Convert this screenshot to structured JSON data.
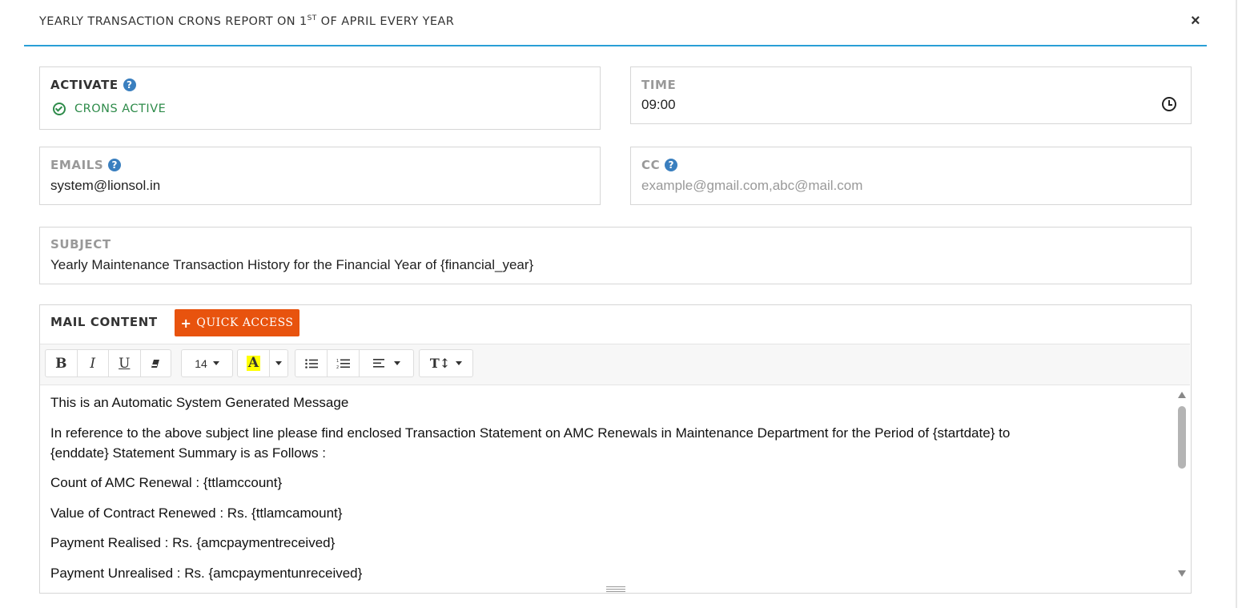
{
  "modal": {
    "title": "YEARLY TRANSACTION CRONS REPORT ON 1",
    "title_sup": "ST",
    "title_rest": " OF APRIL EVERY YEAR",
    "close_label": "×"
  },
  "activate": {
    "label": "ACTIVATE",
    "help": "?",
    "status": "CRONS ACTIVE",
    "status_color": "#2e8b4a"
  },
  "time": {
    "label": "TIME",
    "value": "09:00"
  },
  "emails": {
    "label": "EMAILS",
    "help": "?",
    "value": "system@lionsol.in"
  },
  "cc": {
    "label": "CC",
    "help": "?",
    "placeholder": "example@gmail.com,abc@mail.com"
  },
  "subject": {
    "label": "SUBJECT",
    "value": "Yearly Maintenance Transaction History for the Financial Year of {financial_year}"
  },
  "mail_content": {
    "label": "MAIL CONTENT",
    "quick_access": "QUICK ACCESS",
    "toolbar": {
      "bold": "B",
      "italic": "I",
      "underline": "U",
      "font_size": "14",
      "color_letter": "A",
      "highlight_color": "#ffff00",
      "text_size": "T↕"
    },
    "paragraphs": [
      "This is an Automatic System Generated Message",
      "In reference to the above subject line please find enclosed Transaction Statement on AMC Renewals in Maintenance Department for the Period of {startdate} to {enddate} Statement Summary is as Follows :",
      "Count of AMC Renewal : {ttlamccount}",
      "Value of Contract Renewed : Rs. {ttlamcamount}",
      "Payment Realised : Rs. {amcpaymentreceived}",
      "Payment Unrealised : Rs. {amcpaymentunreceived}"
    ]
  },
  "colors": {
    "accent": "#2a9fd6",
    "button": "#e8530e",
    "help_icon": "#3a7fbf"
  }
}
